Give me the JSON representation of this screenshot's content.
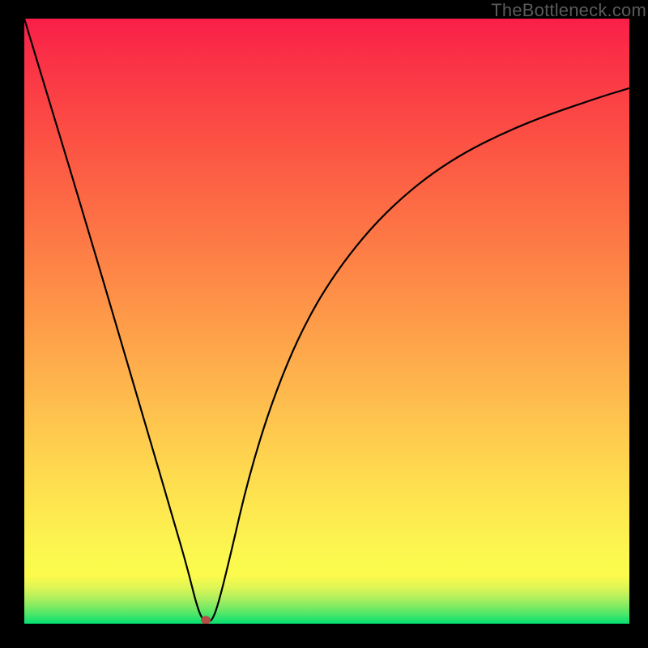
{
  "watermark": "TheBottleneck.com",
  "chart_data": {
    "type": "line",
    "title": "",
    "xlabel": "",
    "ylabel": "",
    "xlim": [
      0,
      100
    ],
    "ylim": [
      0,
      100
    ],
    "series": [
      {
        "name": "curve",
        "x": [
          0,
          5,
          10,
          15,
          20,
          25,
          27,
          28.5,
          29.5,
          30.5,
          31,
          32,
          34,
          37,
          41,
          46,
          52,
          60,
          70,
          82,
          95,
          100
        ],
        "y": [
          100,
          83.5,
          67,
          50,
          33,
          16,
          9,
          3,
          0.5,
          0.5,
          0.5,
          3,
          11,
          24,
          37,
          49,
          59,
          68.5,
          76.5,
          82.5,
          87,
          88.5
        ]
      }
    ],
    "marker": {
      "x": 30,
      "y": 0.6,
      "color": "#b54d46",
      "radius_px": 6
    },
    "background_gradient": {
      "direction": "bottom-to-top",
      "stops": [
        {
          "pct": 0,
          "color": "#03e072"
        },
        {
          "pct": 8,
          "color": "#fdfa4c"
        },
        {
          "pct": 50,
          "color": "#fe9b49"
        },
        {
          "pct": 100,
          "color": "#fa1e48"
        }
      ]
    }
  }
}
